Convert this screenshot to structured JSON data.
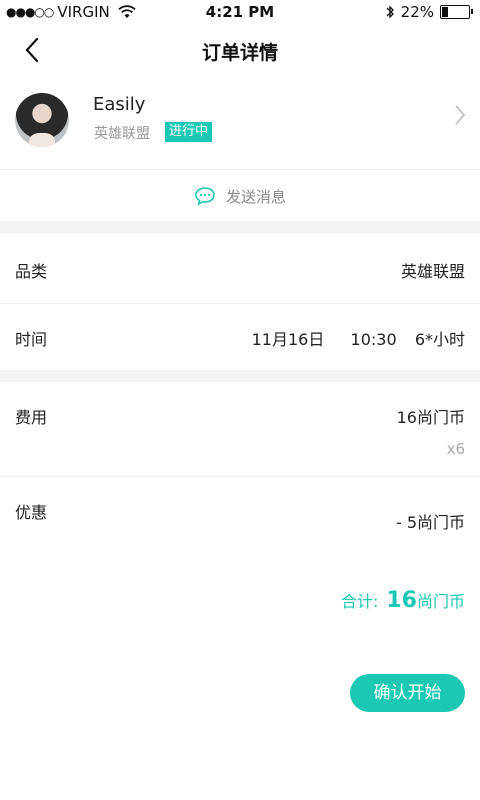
{
  "status_bar": {
    "signal": "●●●○○",
    "carrier": "VIRGIN",
    "time": "4:21 PM",
    "battery_percent": "22%",
    "battery_level": 0.22
  },
  "nav": {
    "title": "订单详情"
  },
  "user": {
    "name": "Easily",
    "game": "英雄联盟",
    "status": "进行中"
  },
  "send_message": {
    "label": "发送消息"
  },
  "details": {
    "category_label": "品类",
    "category_value": "英雄联盟",
    "time_label": "时间",
    "time_date": "11月16日",
    "time_clock": "10:30",
    "time_duration": "6*小时"
  },
  "fees": {
    "fee_label": "费用",
    "fee_value": "16尚门币",
    "fee_multiplier": "x6",
    "discount_label": "优惠",
    "discount_value": "- 5尚门币"
  },
  "total": {
    "label": "合计:",
    "amount": "16",
    "unit": "尚门币"
  },
  "actions": {
    "confirm_label": "确认开始"
  },
  "colors": {
    "accent": "#1bc8b3"
  }
}
